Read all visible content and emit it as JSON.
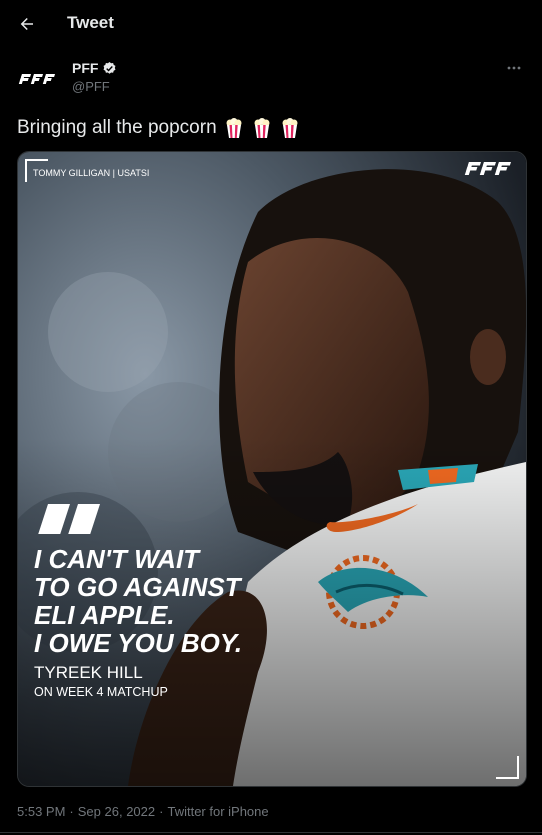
{
  "header": {
    "title": "Tweet",
    "back_icon": "arrow-left-icon"
  },
  "author": {
    "name": "PFF",
    "handle": "@PFF",
    "verified_icon": "verified-badge-icon",
    "logo_text": "PFF"
  },
  "tweet": {
    "text": "Bringing all the popcorn",
    "emojis": [
      "popcorn-icon",
      "popcorn-icon",
      "popcorn-icon"
    ]
  },
  "media": {
    "photo_credit": "TOMMY GILLIGAN | USATSI",
    "brand": "PFF",
    "quote_lines": [
      "I CAN'T WAIT",
      "TO GO AGAINST",
      "ELI APPLE.",
      "I OWE YOU BOY."
    ],
    "speaker": "TYREEK HILL",
    "context": "ON WEEK 4 MATCHUP"
  },
  "meta": {
    "time": "5:53 PM",
    "date": "Sep 26, 2022",
    "source": "Twitter for iPhone",
    "separator": "·"
  },
  "colors": {
    "background": "#000000",
    "text": "#e7e9ea",
    "secondary": "#71767b",
    "dolphins_aqua": "#2aa8b8",
    "dolphins_orange": "#f26a21"
  }
}
